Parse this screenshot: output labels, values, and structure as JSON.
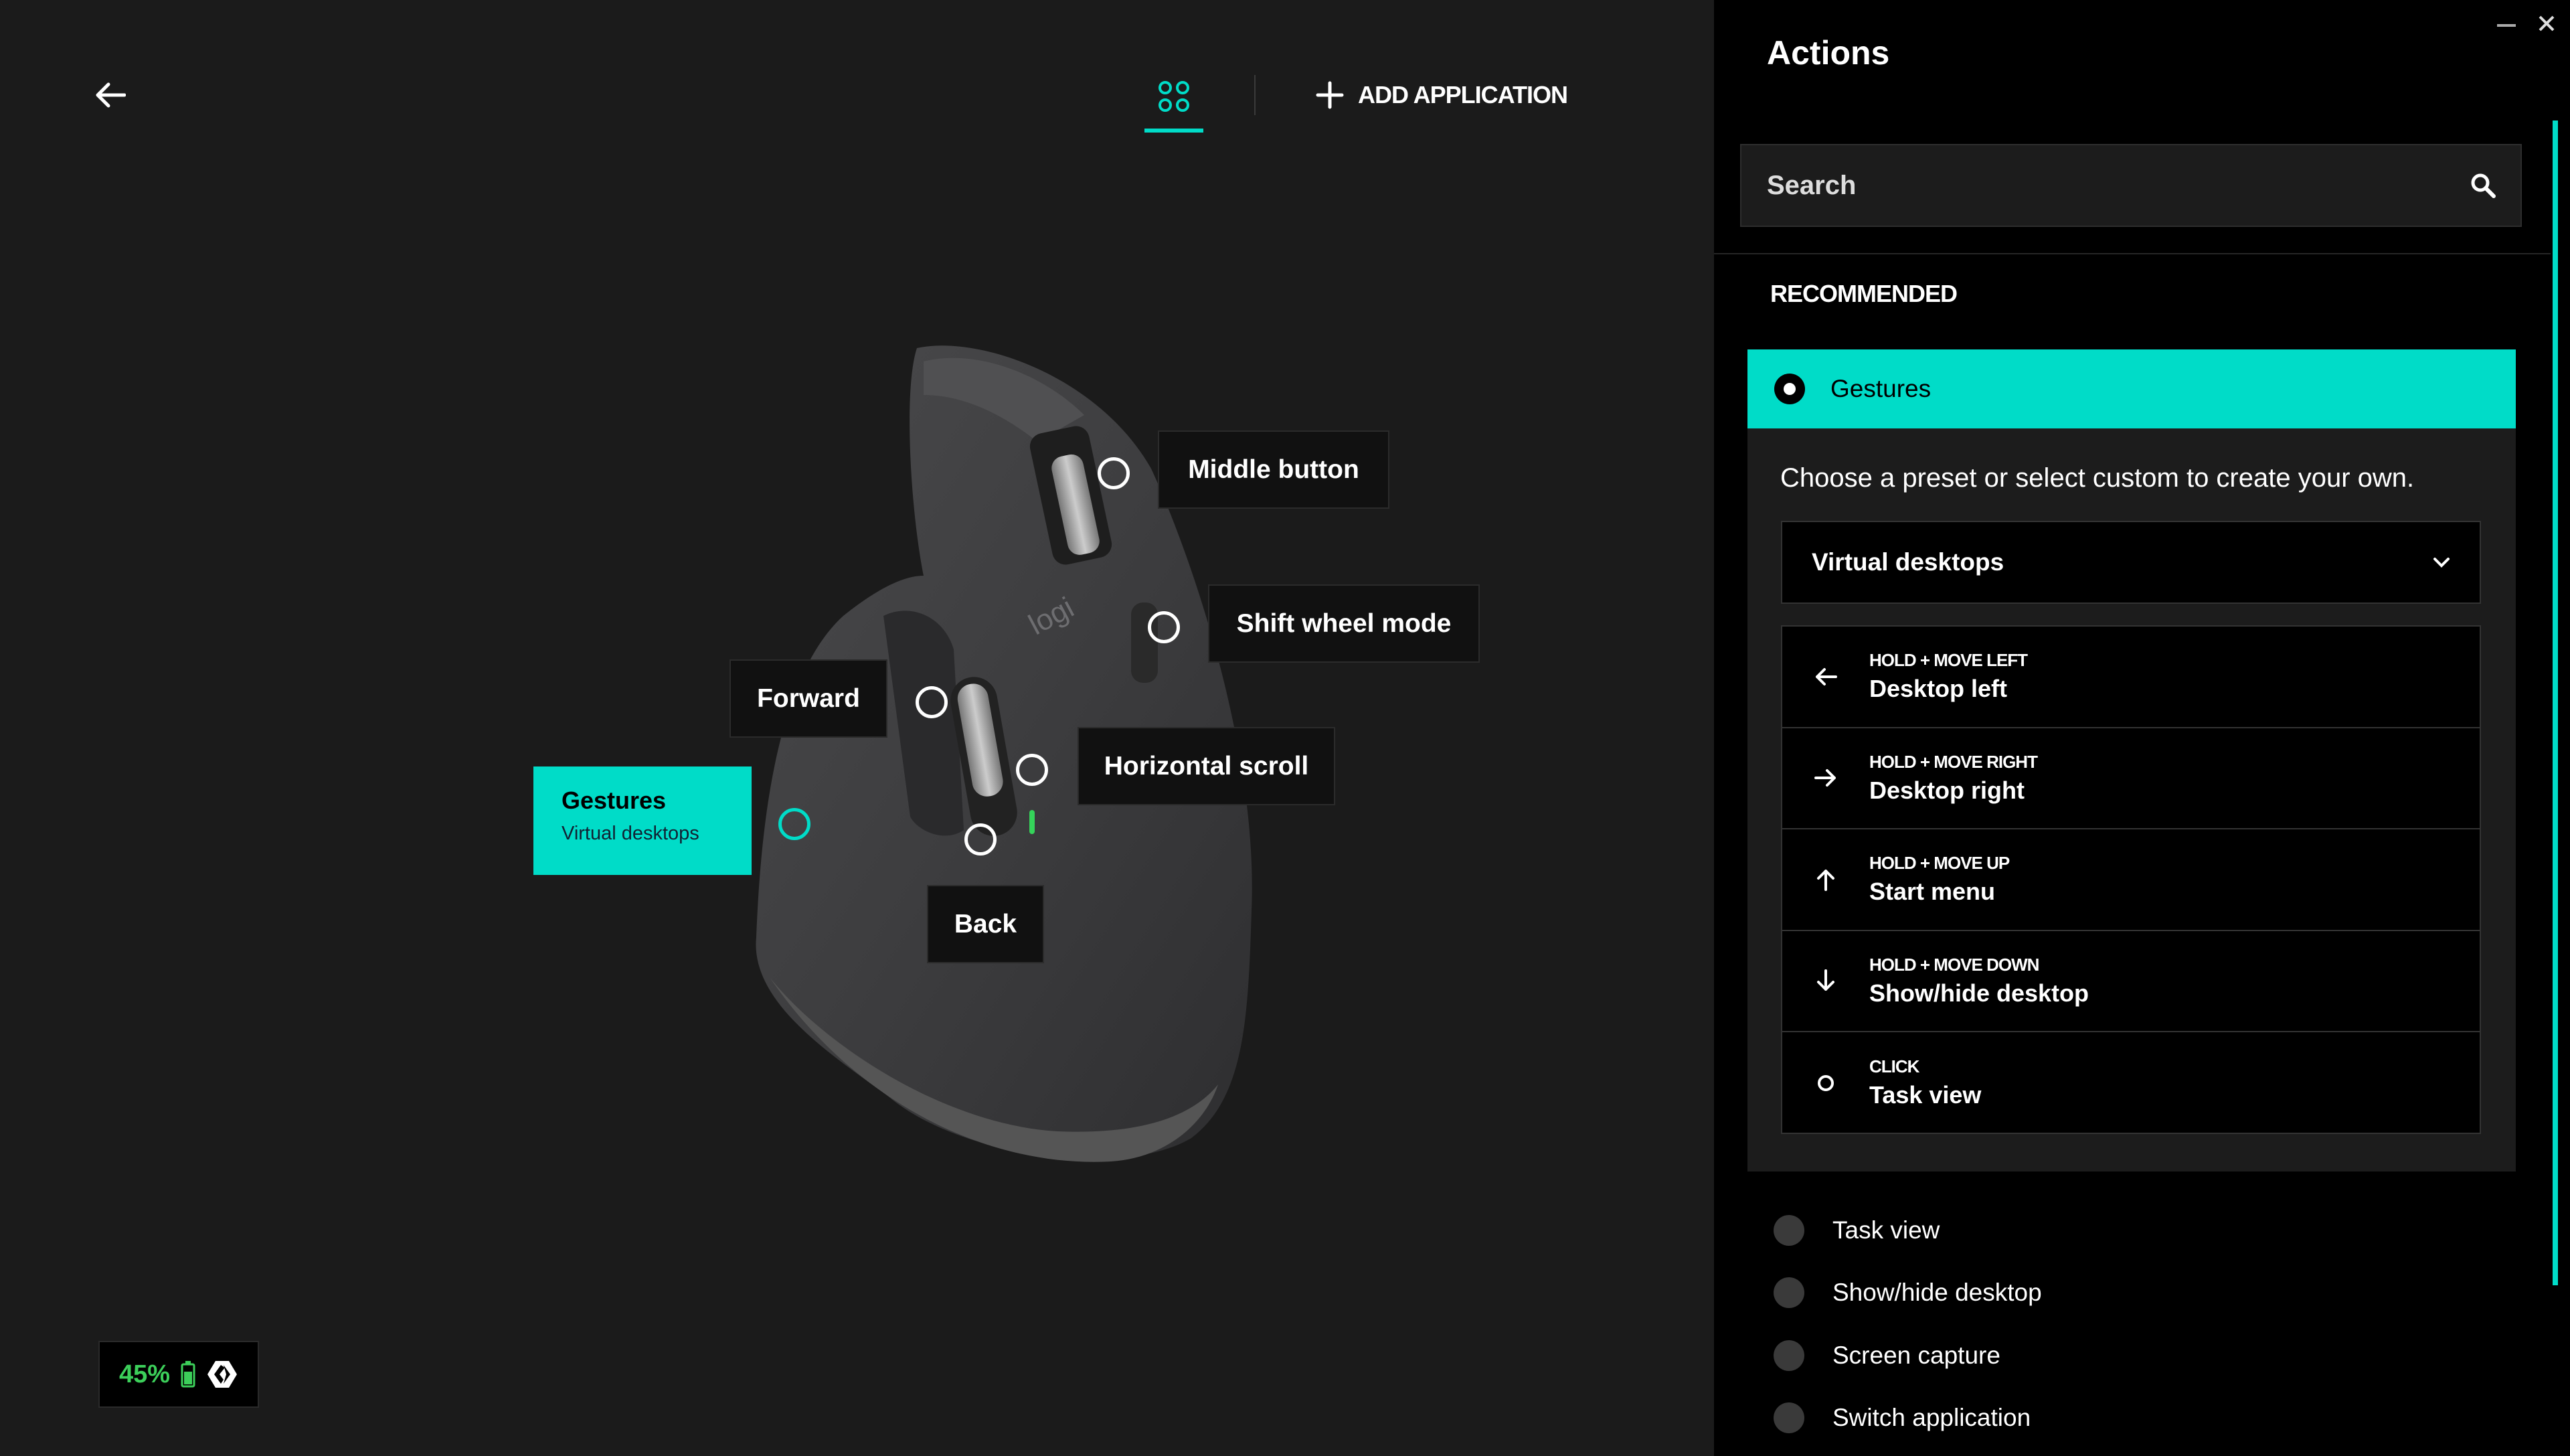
{
  "header": {
    "add_application_label": "ADD APPLICATION"
  },
  "callouts": {
    "middle_button": "Middle button",
    "shift_wheel_mode": "Shift wheel mode",
    "forward": "Forward",
    "horizontal_scroll": "Horizontal scroll",
    "back": "Back",
    "gestures": {
      "title": "Gestures",
      "subtitle": "Virtual desktops"
    }
  },
  "mouse": {
    "logo_text": "logi"
  },
  "battery": {
    "percent": "45%"
  },
  "panel": {
    "title": "Actions",
    "search_placeholder": "Search",
    "section_label": "RECOMMENDED",
    "selected_action": "Gestures",
    "description": "Choose a preset or select custom to create your own.",
    "preset": "Virtual desktops",
    "preset_actions": [
      {
        "icon": "arrow-left-icon",
        "caption": "HOLD + MOVE LEFT",
        "name": "Desktop left"
      },
      {
        "icon": "arrow-right-icon",
        "caption": "HOLD + MOVE RIGHT",
        "name": "Desktop right"
      },
      {
        "icon": "arrow-up-icon",
        "caption": "HOLD + MOVE UP",
        "name": "Start menu"
      },
      {
        "icon": "arrow-down-icon",
        "caption": "HOLD + MOVE DOWN",
        "name": "Show/hide desktop"
      },
      {
        "icon": "circle-icon",
        "caption": "CLICK",
        "name": "Task view"
      }
    ],
    "other_actions": [
      "Task view",
      "Show/hide desktop",
      "Screen capture",
      "Switch application"
    ]
  },
  "colors": {
    "accent": "#00dcc8",
    "battery": "#3ccf5a",
    "background": "#1b1b1b",
    "panel": "#000000"
  }
}
